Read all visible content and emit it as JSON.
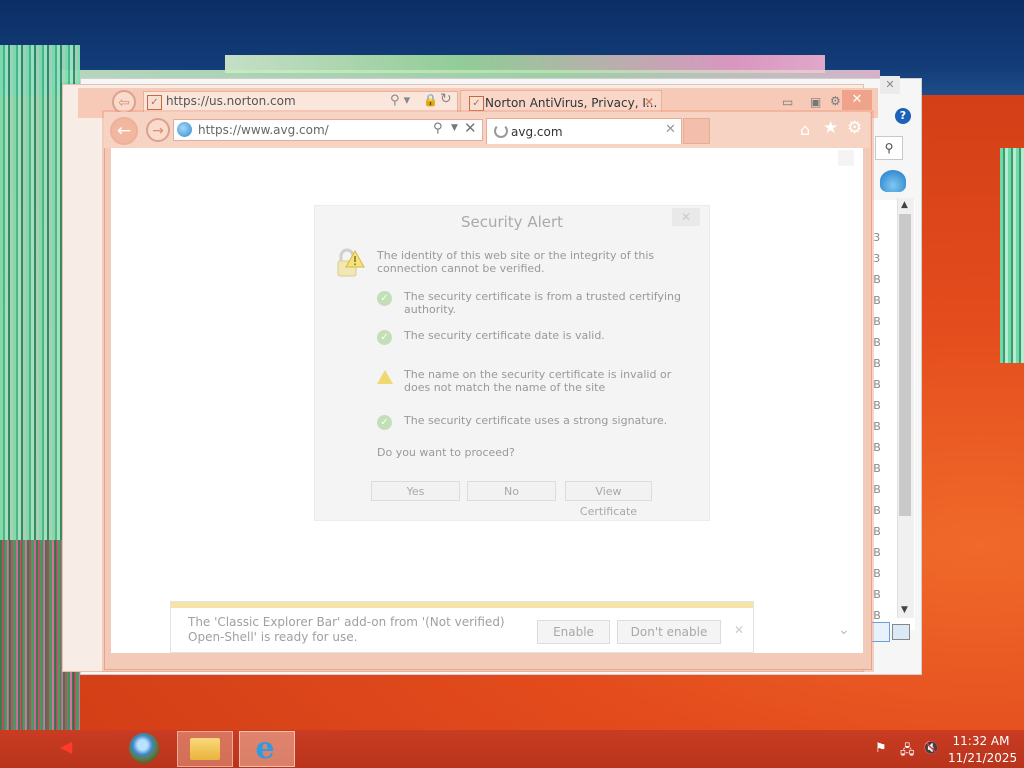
{
  "browser_back": {
    "address": "https://us.norton.com",
    "tab_label": "Norton AntiVirus, Privacy, I..."
  },
  "browser_main": {
    "address": "https://www.avg.com/",
    "tab_label": "avg.com"
  },
  "security_alert": {
    "title": "Security Alert",
    "intro": "The identity of this web site or the integrity of this connection cannot be verified.",
    "items": [
      {
        "status": "ok",
        "text": "The security certificate is from a trusted certifying authority."
      },
      {
        "status": "ok",
        "text": "The security certificate date is valid."
      },
      {
        "status": "warning",
        "text": "The name on the security certificate is invalid or does not match the name of the site"
      },
      {
        "status": "ok",
        "text": "The security certificate uses a strong signature."
      }
    ],
    "question": "Do you want to proceed?",
    "buttons": {
      "yes": "Yes",
      "no": "No",
      "view_certificate": "View Certificate"
    }
  },
  "notification": {
    "text": "The 'Classic Explorer Bar' add-on from '(Not verified) Open-Shell' is ready for use.",
    "enable": "Enable",
    "dont_enable": "Don't enable"
  },
  "taskbar": {
    "time": "11:32 AM",
    "date": "11/21/2025"
  },
  "icons": {
    "back": "back-arrow-icon",
    "forward": "forward-arrow-icon",
    "home": "home-icon",
    "favorites": "star-icon",
    "tools": "gear-icon",
    "help": "help-icon"
  },
  "colors": {
    "accent_orange": "#e24b1c",
    "taskbar": "#c83c22",
    "window_chrome": "#f3cab8"
  }
}
